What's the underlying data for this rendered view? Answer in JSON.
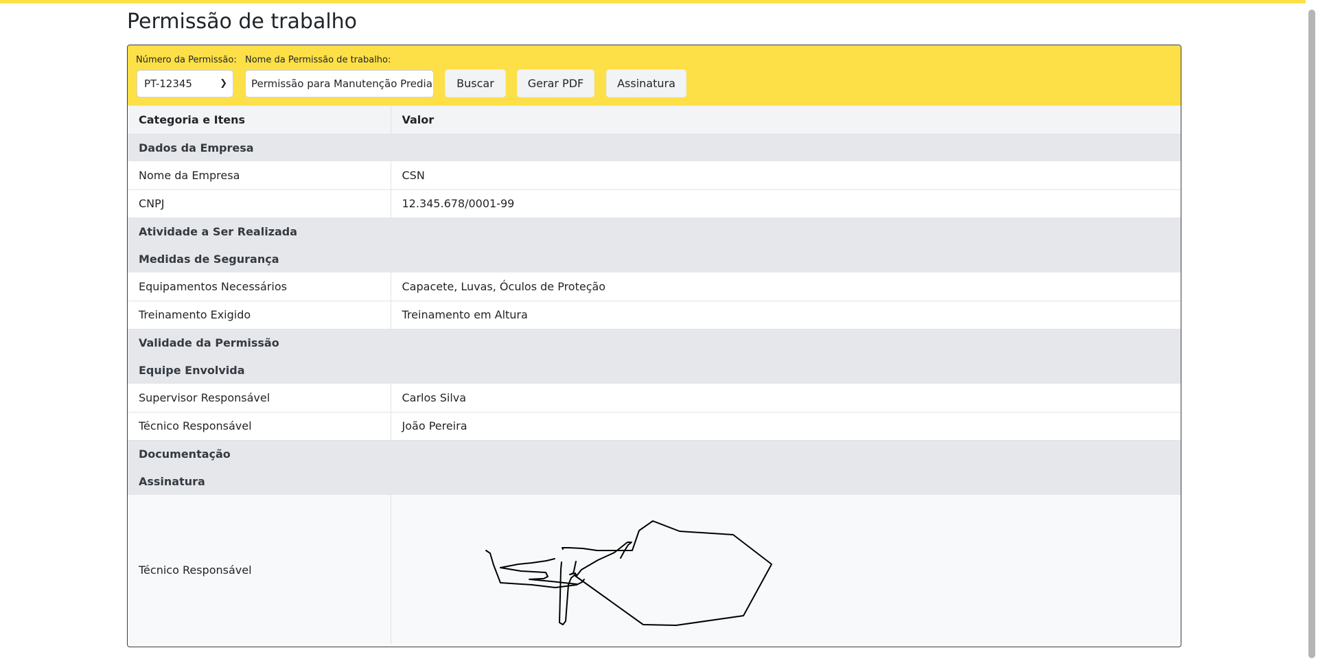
{
  "page": {
    "title": "Permissão de trabalho"
  },
  "toolbar": {
    "numero_label": "Número da Permissão:",
    "nome_label": "Nome da Permissão de trabalho:",
    "numero_value": "PT-12345",
    "nome_value": "Permissão para Manutenção Predial",
    "buscar_label": "Buscar",
    "gerar_pdf_label": "Gerar PDF",
    "assinatura_label": "Assinatura"
  },
  "table": {
    "headers": [
      "Categoria e Itens",
      "Valor"
    ],
    "sections": {
      "dados_empresa": "Dados da Empresa",
      "atividade": "Atividade a Ser Realizada",
      "medidas": "Medidas de Segurança",
      "validade": "Validade da Permissão",
      "equipe": "Equipe Envolvida",
      "documentacao": "Documentação",
      "assinatura": "Assinatura"
    },
    "rows": {
      "nome_empresa": {
        "label": "Nome da Empresa",
        "value": "CSN"
      },
      "cnpj": {
        "label": "CNPJ",
        "value": "12.345.678/0001-99"
      },
      "equipamentos": {
        "label": "Equipamentos Necessários",
        "value": "Capacete, Luvas, Óculos de Proteção"
      },
      "treinamento": {
        "label": "Treinamento Exigido",
        "value": "Treinamento em Altura"
      },
      "supervisor": {
        "label": "Supervisor Responsável",
        "value": "Carlos Silva"
      },
      "tecnico": {
        "label": "Técnico Responsável",
        "value": "João Pereira"
      },
      "assinatura_tecnico": {
        "label": "Técnico Responsável"
      }
    }
  },
  "colors": {
    "accent": "#fde047",
    "header_bg": "#f3f4f6",
    "section_bg": "#e5e7eb"
  },
  "icons": {
    "select_chevron": "chevron-down-icon"
  }
}
